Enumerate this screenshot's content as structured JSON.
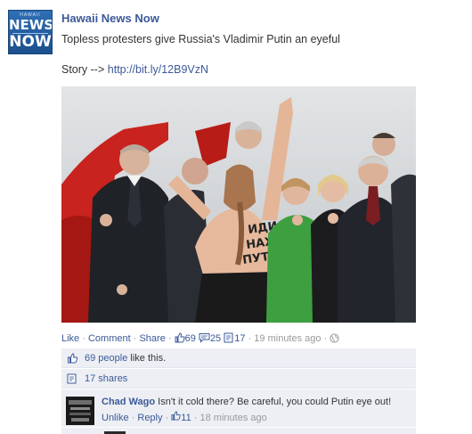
{
  "post": {
    "avatar": {
      "top_text": "HAWAII",
      "line1": "NEWS",
      "line2": "NOW"
    },
    "author": "Hawaii News Now",
    "message": "Topless protesters give Russia's Vladimir Putin an eyeful",
    "story_label": "Story -->",
    "story_link": "http://bit.ly/12B9VzN",
    "photo_text": "ИДИ НАХУ ПУТИН"
  },
  "actions": {
    "like": "Like",
    "comment": "Comment",
    "share": "Share",
    "likes_count": "69",
    "comments_count": "25",
    "shares_count": "17",
    "time": "19 minutes ago",
    "sep": "·"
  },
  "ufi": {
    "likes_people": "69 people",
    "likes_suffix": " like this.",
    "shares": "17 shares"
  },
  "comment": {
    "author": "Chad Wago",
    "text": "Isn't it cold there? Be careful, you could Putin eye out!",
    "unlike": "Unlike",
    "reply": "Reply",
    "likes": "11",
    "time": "18 minutes ago"
  },
  "colors": {
    "brand_blue": "#3b5998",
    "ufi_bg": "#edeff4",
    "muted": "#999999"
  }
}
